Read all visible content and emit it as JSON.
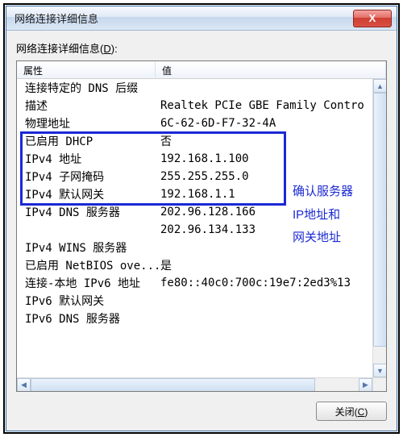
{
  "window": {
    "title": "网络连接详细信息",
    "close_x": "X"
  },
  "body_label": "网络连接详细信息(D):",
  "columns": {
    "prop": "属性",
    "val": "值"
  },
  "rows": [
    {
      "prop": "连接特定的 DNS 后缀",
      "val": ""
    },
    {
      "prop": "描述",
      "val": "Realtek PCIe GBE Family Contro"
    },
    {
      "prop": "物理地址",
      "val": "6C-62-6D-F7-32-4A"
    },
    {
      "prop": "已启用 DHCP",
      "val": "否"
    },
    {
      "prop": "IPv4 地址",
      "val": "192.168.1.100"
    },
    {
      "prop": "IPv4 子网掩码",
      "val": "255.255.255.0"
    },
    {
      "prop": "IPv4 默认网关",
      "val": "192.168.1.1"
    },
    {
      "prop": "IPv4 DNS 服务器",
      "val": "202.96.128.166"
    },
    {
      "prop": "",
      "val": "202.96.134.133"
    },
    {
      "prop": "IPv4 WINS 服务器",
      "val": ""
    },
    {
      "prop": "已启用 NetBIOS ove...",
      "val": "是"
    },
    {
      "prop": "连接-本地 IPv6 地址",
      "val": "fe80::40c0:700c:19e7:2ed3%13"
    },
    {
      "prop": "IPv6 默认网关",
      "val": ""
    },
    {
      "prop": "IPv6 DNS 服务器",
      "val": ""
    }
  ],
  "annotations": {
    "line1": "确认服务器",
    "line2": "IP地址和",
    "line3": "网关地址"
  },
  "footer": {
    "close_label": "关闭(C)"
  },
  "scroll": {
    "up": "▲",
    "down": "▼",
    "left": "◀",
    "right": "▶"
  }
}
